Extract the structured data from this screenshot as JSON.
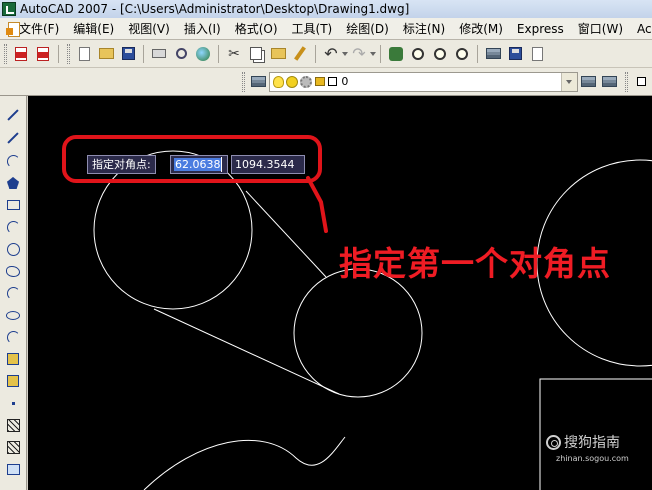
{
  "window": {
    "title": "AutoCAD 2007 - [C:\\Users\\Administrator\\Desktop\\Drawing1.dwg]"
  },
  "menu": {
    "items": [
      "文件(F)",
      "编辑(E)",
      "视图(V)",
      "插入(I)",
      "格式(O)",
      "工具(T)",
      "绘图(D)",
      "标注(N)",
      "修改(M)",
      "Express",
      "窗口(W)",
      "Acr"
    ]
  },
  "layer_toolbar": {
    "current_layer": "0"
  },
  "dynamic_input": {
    "prompt": "指定对角点:",
    "x_value": "62.0638",
    "y_value": "1094.3544"
  },
  "annotation": {
    "text": "指定第一个对角点"
  },
  "watermark": {
    "logo_text": "搜狗指南",
    "url_text": "zhinan.sogou.com"
  },
  "colors": {
    "canvas_bg": "#000000",
    "annotation_red": "#ef1c24",
    "highlight_box": "#e0141a",
    "selection_blue": "#4a7ce0"
  }
}
